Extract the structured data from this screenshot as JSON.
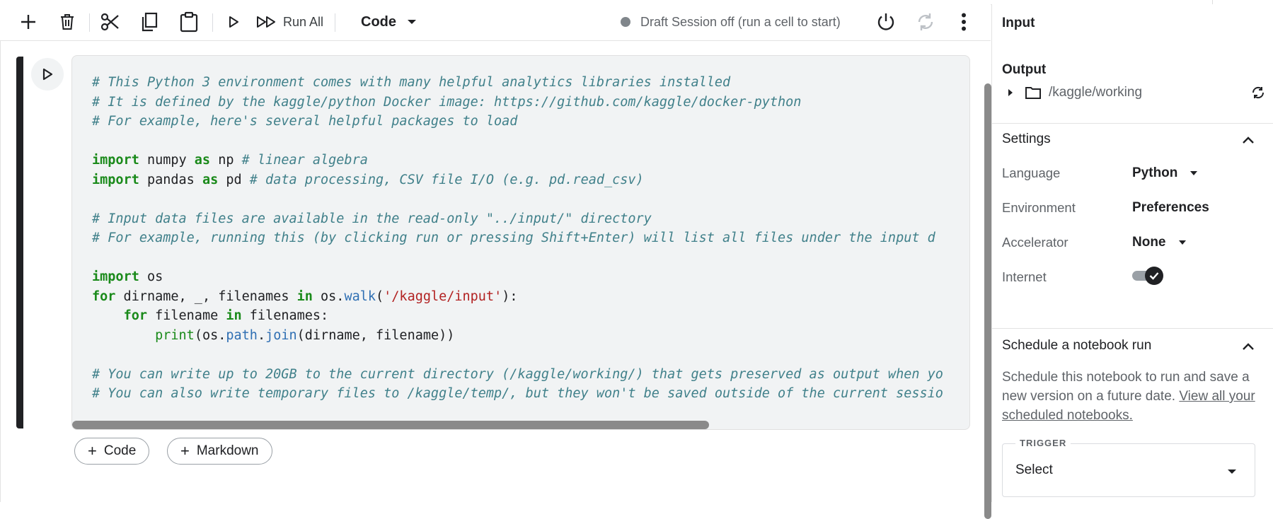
{
  "toolbar": {
    "run_all_label": "Run All",
    "cell_type": "Code",
    "session_status": "Draft Session off (run a cell to start)"
  },
  "cell": {
    "code_lines": [
      [
        {
          "t": "cm",
          "v": "# This Python 3 environment comes with many helpful analytics libraries installed"
        }
      ],
      [
        {
          "t": "cm",
          "v": "# It is defined by the kaggle/python Docker image: https://github.com/kaggle/docker-python"
        }
      ],
      [
        {
          "t": "cm",
          "v": "# For example, here's several helpful packages to load"
        }
      ],
      [],
      [
        {
          "t": "kw",
          "v": "import"
        },
        {
          "t": "tx",
          "v": " numpy "
        },
        {
          "t": "kw",
          "v": "as"
        },
        {
          "t": "tx",
          "v": " np "
        },
        {
          "t": "cm",
          "v": "# linear algebra"
        }
      ],
      [
        {
          "t": "kw",
          "v": "import"
        },
        {
          "t": "tx",
          "v": " pandas "
        },
        {
          "t": "kw",
          "v": "as"
        },
        {
          "t": "tx",
          "v": " pd "
        },
        {
          "t": "cm",
          "v": "# data processing, CSV file I/O (e.g. pd.read_csv)"
        }
      ],
      [],
      [
        {
          "t": "cm",
          "v": "# Input data files are available in the read-only \"../input/\" directory"
        }
      ],
      [
        {
          "t": "cm",
          "v": "# For example, running this (by clicking run or pressing Shift+Enter) will list all files under the input d"
        }
      ],
      [],
      [
        {
          "t": "kw",
          "v": "import"
        },
        {
          "t": "tx",
          "v": " os"
        }
      ],
      [
        {
          "t": "kw",
          "v": "for"
        },
        {
          "t": "tx",
          "v": " dirname, _, filenames "
        },
        {
          "t": "kw",
          "v": "in"
        },
        {
          "t": "tx",
          "v": " os."
        },
        {
          "t": "fn",
          "v": "walk"
        },
        {
          "t": "tx",
          "v": "("
        },
        {
          "t": "str",
          "v": "'/kaggle/input'"
        },
        {
          "t": "tx",
          "v": "):"
        }
      ],
      [
        {
          "t": "tx",
          "v": "    "
        },
        {
          "t": "kw",
          "v": "for"
        },
        {
          "t": "tx",
          "v": " filename "
        },
        {
          "t": "kw",
          "v": "in"
        },
        {
          "t": "tx",
          "v": " filenames:"
        }
      ],
      [
        {
          "t": "tx",
          "v": "        "
        },
        {
          "t": "bi",
          "v": "print"
        },
        {
          "t": "tx",
          "v": "(os."
        },
        {
          "t": "fn",
          "v": "path"
        },
        {
          "t": "tx",
          "v": "."
        },
        {
          "t": "fn",
          "v": "join"
        },
        {
          "t": "tx",
          "v": "(dirname, filename))"
        }
      ],
      [],
      [
        {
          "t": "cm",
          "v": "# You can write up to 20GB to the current directory (/kaggle/working/) that gets preserved as output when yo"
        }
      ],
      [
        {
          "t": "cm",
          "v": "# You can also write temporary files to /kaggle/temp/, but they won't be saved outside of the current sessio"
        }
      ]
    ]
  },
  "add_cell": {
    "code_label": "Code",
    "markdown_label": "Markdown"
  },
  "panel": {
    "input_title": "Input",
    "output_title": "Output",
    "output_folder": "/kaggle/working",
    "settings": {
      "title": "Settings",
      "language_label": "Language",
      "language_value": "Python",
      "environment_label": "Environment",
      "environment_value": "Preferences",
      "accelerator_label": "Accelerator",
      "accelerator_value": "None",
      "internet_label": "Internet",
      "internet_on": true
    },
    "schedule": {
      "title": "Schedule a notebook run",
      "description": "Schedule this notebook to run and save a new version on a future date.",
      "link_text": "View all your scheduled notebooks.",
      "trigger_label": "TRIGGER",
      "trigger_value": "Select"
    }
  }
}
